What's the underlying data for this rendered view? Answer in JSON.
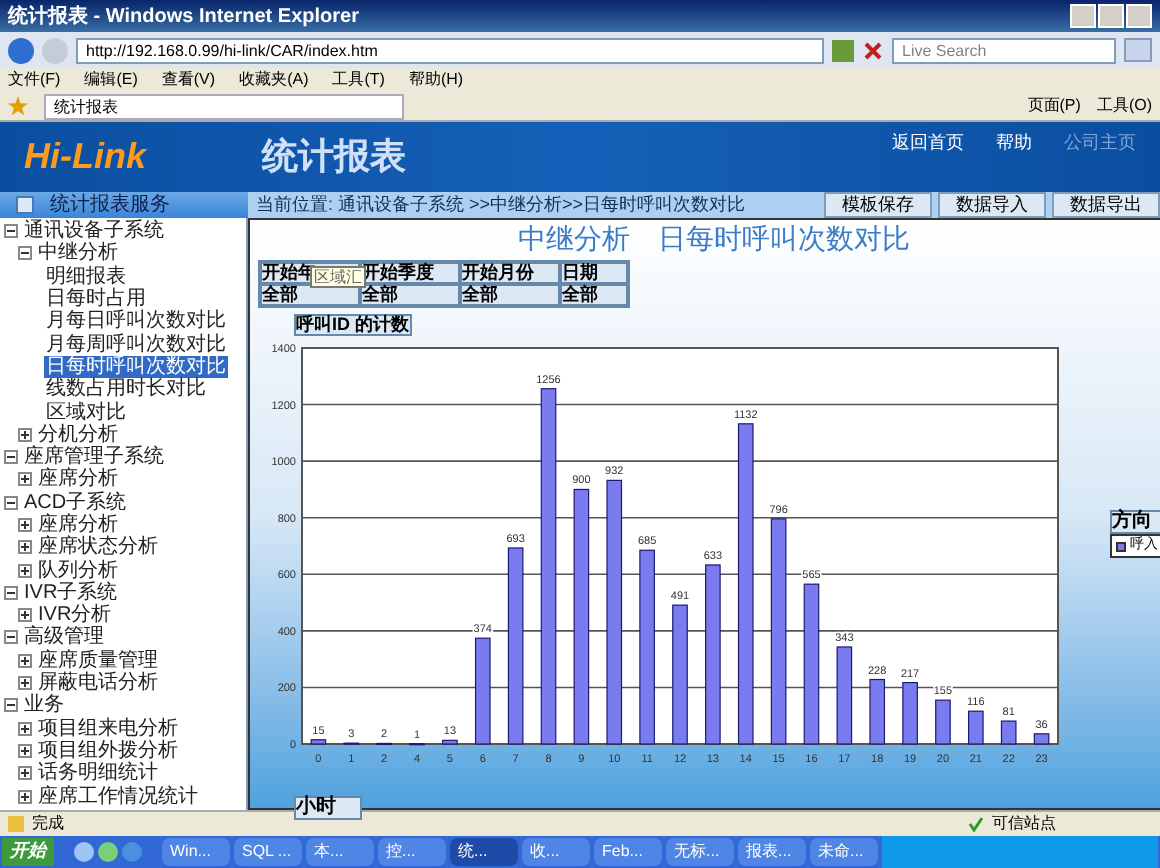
{
  "window": {
    "title": "统计报表 - Windows Internet Explorer"
  },
  "address_bar": {
    "url": "http://192.168.0.99/hi-link/CAR/index.htm"
  },
  "search": {
    "placeholder": "Live Search"
  },
  "menu": [
    "文件(F)",
    "编辑(E)",
    "查看(V)",
    "收藏夹(A)",
    "工具(T)",
    "帮助(H)"
  ],
  "favorites_tab": {
    "label": "统计报表"
  },
  "command_bar": [
    "页面(P)",
    "工具(O)"
  ],
  "banner": {
    "logo": "Hi-Link",
    "title": "统计报表",
    "links": [
      {
        "label": "返回首页",
        "disabled": false
      },
      {
        "label": "帮助",
        "disabled": false
      },
      {
        "label": "公司主页",
        "disabled": true
      }
    ]
  },
  "sidebar": {
    "title": "统计报表服务",
    "tree": [
      {
        "label": "通讯设备子系统",
        "expanded": true,
        "selected": false,
        "children": [
          {
            "label": "中继分析",
            "expanded": true,
            "selected": false,
            "children": [
              {
                "label": "明细报表",
                "selected": false
              },
              {
                "label": "日每时占用",
                "selected": false
              },
              {
                "label": "月每日呼叫次数对比",
                "selected": false
              },
              {
                "label": "月每周呼叫次数对比",
                "selected": false
              },
              {
                "label": "日每时呼叫次数对比",
                "selected": true
              },
              {
                "label": "线数占用时长对比",
                "selected": false
              },
              {
                "label": "区域对比",
                "selected": false
              }
            ]
          },
          {
            "label": "分机分析",
            "expanded": false,
            "selected": false
          }
        ]
      },
      {
        "label": "座席管理子系统",
        "expanded": true,
        "selected": false,
        "children": [
          {
            "label": "座席分析",
            "expanded": false,
            "selected": false
          }
        ]
      },
      {
        "label": "ACD子系统",
        "expanded": true,
        "selected": false,
        "children": [
          {
            "label": "座席分析",
            "expanded": false,
            "selected": false
          },
          {
            "label": "座席状态分析",
            "expanded": false,
            "selected": false
          },
          {
            "label": "队列分析",
            "expanded": false,
            "selected": false
          }
        ]
      },
      {
        "label": "IVR子系统",
        "expanded": true,
        "selected": false,
        "children": [
          {
            "label": "IVR分析",
            "expanded": false,
            "selected": false
          }
        ]
      },
      {
        "label": "高级管理",
        "expanded": true,
        "selected": false,
        "children": [
          {
            "label": "座席质量管理",
            "expanded": false,
            "selected": false
          },
          {
            "label": "屏蔽电话分析",
            "expanded": false,
            "selected": false
          }
        ]
      },
      {
        "label": "业务",
        "expanded": true,
        "selected": false,
        "children": [
          {
            "label": "项目组来电分析",
            "expanded": false,
            "selected": false
          },
          {
            "label": "项目组外拨分析",
            "expanded": false,
            "selected": false
          },
          {
            "label": "话务明细统计",
            "expanded": false,
            "selected": false
          },
          {
            "label": "座席工作情况统计",
            "expanded": false,
            "selected": false
          }
        ]
      }
    ]
  },
  "breadcrumb": "当前位置: 通讯设备子系统 >>中继分析>>日每时呼叫次数对比",
  "toolbar_buttons": [
    "模板保存",
    "数据导入",
    "数据导出"
  ],
  "report": {
    "title": "中继分析　日每时呼叫次数对比",
    "filters": [
      {
        "name": "开始年",
        "value": "全部"
      },
      {
        "name": "开始季度",
        "value": "全部"
      },
      {
        "name": "开始月份",
        "value": "全部"
      },
      {
        "name": "日期",
        "value": "全部"
      }
    ],
    "tooltip": "区域汇",
    "measure": "呼叫ID 的计数",
    "axis_field": "小时",
    "legend_title": "方向",
    "chart_data": {
      "type": "bar",
      "categories": [
        "0",
        "1",
        "2",
        "4",
        "5",
        "6",
        "7",
        "8",
        "9",
        "10",
        "11",
        "12",
        "13",
        "14",
        "15",
        "16",
        "17",
        "18",
        "19",
        "20",
        "21",
        "22",
        "23"
      ],
      "series": [
        {
          "name": "呼入",
          "color": "#7b7bf0",
          "values": [
            15,
            3,
            2,
            1,
            13,
            374,
            693,
            1256,
            900,
            932,
            685,
            491,
            633,
            1132,
            796,
            565,
            343,
            228,
            217,
            155,
            116,
            81,
            36
          ]
        }
      ],
      "ylim": [
        0,
        1400
      ],
      "grid": true,
      "yticks": [
        0,
        200,
        400,
        600,
        800,
        1000,
        1200,
        1400
      ],
      "data_labels": true
    }
  },
  "status_bar": {
    "text": "完成",
    "zone": "可信站点"
  },
  "taskbar": {
    "start": "开始",
    "items": [
      {
        "label": "Win...",
        "selected": false
      },
      {
        "label": "SQL ...",
        "selected": false
      },
      {
        "label": "本...",
        "selected": false
      },
      {
        "label": "控...",
        "selected": false
      },
      {
        "label": "统...",
        "selected": true
      },
      {
        "label": "收...",
        "selected": false
      },
      {
        "label": "Feb...",
        "selected": false
      },
      {
        "label": "无标...",
        "selected": false
      },
      {
        "label": "报表...",
        "selected": false
      },
      {
        "label": "未命...",
        "selected": false
      }
    ]
  }
}
